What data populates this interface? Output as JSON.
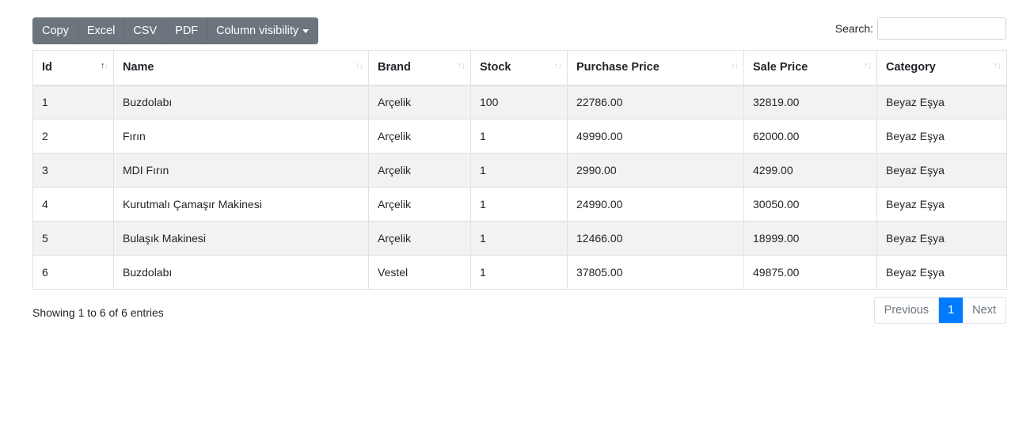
{
  "toolbar": {
    "buttons": [
      "Copy",
      "Excel",
      "CSV",
      "PDF",
      "Column visibility"
    ],
    "search_label": "Search:",
    "search_value": "",
    "search_placeholder": ""
  },
  "table": {
    "columns": [
      "Id",
      "Name",
      "Brand",
      "Stock",
      "Purchase Price",
      "Sale Price",
      "Category"
    ],
    "rows": [
      [
        "1",
        "Buzdolabı",
        "Arçelik",
        "100",
        "22786.00",
        "32819.00",
        "Beyaz Eşya"
      ],
      [
        "2",
        "Fırın",
        "Arçelik",
        "1",
        "49990.00",
        "62000.00",
        "Beyaz Eşya"
      ],
      [
        "3",
        "MDI Fırın",
        "Arçelik",
        "1",
        "2990.00",
        "4299.00",
        "Beyaz Eşya"
      ],
      [
        "4",
        "Kurutmalı Çamaşır Makinesi",
        "Arçelik",
        "1",
        "24990.00",
        "30050.00",
        "Beyaz Eşya"
      ],
      [
        "5",
        "Bulaşık Makinesi",
        "Arçelik",
        "1",
        "12466.00",
        "18999.00",
        "Beyaz Eşya"
      ],
      [
        "6",
        "Buzdolabı",
        "Vestel",
        "1",
        "37805.00",
        "49875.00",
        "Beyaz Eşya"
      ]
    ],
    "sorted_column": "Id",
    "sort_direction": "ascending"
  },
  "footer": {
    "info": "Showing 1 to 6 of 6 entries",
    "previous": "Previous",
    "current_page": "1",
    "next": "Next"
  },
  "colors": {
    "button_bg": "#6c757d",
    "active_page": "#007bff",
    "stripe": "#f2f2f2",
    "border": "#dee2e6"
  }
}
